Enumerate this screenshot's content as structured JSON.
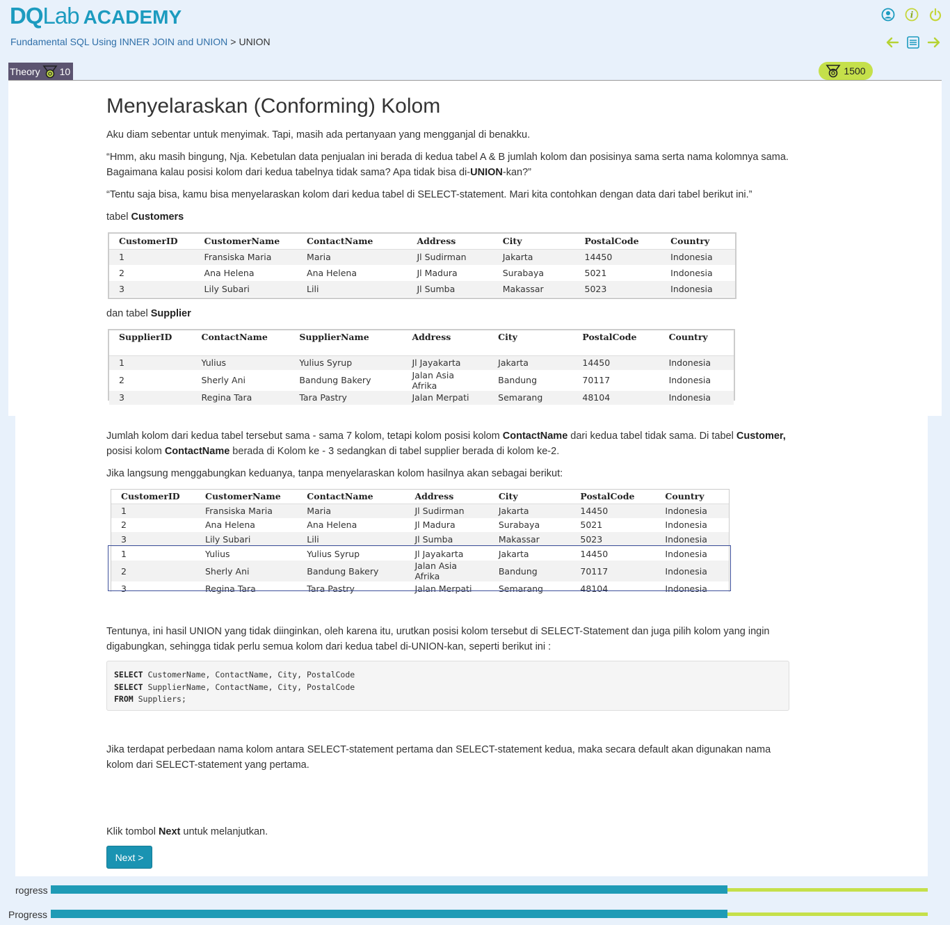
{
  "header": {
    "logo_dq": "DQ",
    "logo_lab": "Lab",
    "logo_academy": "ACADEMY",
    "breadcrumb": {
      "course": "Fundamental SQL Using INNER JOIN and UNION",
      "separator": ">",
      "current": "UNION"
    },
    "icons": [
      "user-icon",
      "info-icon",
      "power-icon"
    ],
    "nav_icons": [
      "arrow-left-icon",
      "list-icon",
      "arrow-right-icon"
    ],
    "theory_label": "Theory",
    "theory_points": "10",
    "total_points": "1500",
    "accent": "#1c9bbf",
    "badge_color": "#c5e04a"
  },
  "lesson": {
    "title": "Menyelaraskan (Conforming) Kolom",
    "p1": "Aku diam sebentar untuk menyimak. Tapi, masih ada pertanyaan yang mengganjal di benakku.",
    "p2_a": "“Hmm, aku masih bingung, Nja. Kebetulan data penjualan ini berada di kedua tabel A & B jumlah kolom dan posisinya sama serta nama kolomnya sama. Bagaimana kalau posisi kolom dari kedua tabelnya tidak sama? Apa tidak bisa di-",
    "p2_b": "UNION",
    "p2_c": "-kan?”",
    "p3": "“Tentu saja bisa, kamu bisa menyelaraskan kolom dari kedua tabel di SELECT-statement. Mari kita contohkan dengan data dari tabel berikut ini.”",
    "customers_prefix": "tabel ",
    "customers_name": "Customers",
    "supplier_prefix": "dan tabel ",
    "supplier_name": "Supplier",
    "p4_a": "Jumlah kolom dari kedua tabel tersebut sama - sama 7 kolom, tetapi kolom posisi kolom ",
    "p4_b": "ContactName",
    "p4_c": " dari kedua tabel tidak sama. Di tabel ",
    "p4_d": "Customer,",
    "p4_e": " posisi kolom ",
    "p4_f": "ContactName",
    "p4_g": " berada di Kolom ke - 3 sedangkan di tabel supplier berada di kolom ke-2.",
    "p5": "Jika langsung menggabungkan keduanya, tanpa menyelaraskan kolom hasilnya akan sebagai berikut:",
    "p6": "Tentunya, ini hasil UNION yang tidak diinginkan, oleh karena itu, urutkan posisi kolom tersebut di SELECT-Statement dan juga pilih kolom yang ingin digabungkan, sehingga tidak perlu semua kolom dari kedua tabel di-UNION-kan, seperti berikut ini :",
    "code": [
      {
        "kw": "SELECT",
        "rest": " CustomerName, ContactName, City, PostalCode"
      },
      {
        "kw": "SELECT",
        "rest": " SupplierName, ContactName, City, PostalCode"
      },
      {
        "kw": "FROM",
        "rest": " Suppliers;"
      }
    ],
    "p7": "Jika terdapat perbedaan nama kolom antara SELECT-statement pertama dan SELECT-statement kedua, maka secara default akan digunakan nama kolom dari SELECT-statement yang pertama.",
    "p8_a": "Klik tombol ",
    "p8_b": "Next",
    "p8_c": " untuk melanjutkan.",
    "next_label": "Next >"
  },
  "customers_table": {
    "headers": [
      "CustomerID",
      "CustomerName",
      "ContactName",
      "Address",
      "City",
      "PostalCode",
      "Country"
    ],
    "rows": [
      [
        "1",
        "Fransiska Maria",
        "Maria",
        "Jl Sudirman",
        "Jakarta",
        "14450",
        "Indonesia"
      ],
      [
        "2",
        "Ana Helena",
        "Ana Helena",
        "Jl Madura",
        "Surabaya",
        "5021",
        "Indonesia"
      ],
      [
        "3",
        "Lily Subari",
        "Lili",
        "Jl Sumba",
        "Makassar",
        "5023",
        "Indonesia"
      ]
    ]
  },
  "supplier_table": {
    "headers": [
      "SupplierID",
      "ContactName",
      "SupplierName",
      "Address",
      "City",
      "PostalCode",
      "Country"
    ],
    "rows": [
      [
        "1",
        "Yulius",
        "Yulius Syrup",
        "Jl Jayakarta",
        "Jakarta",
        "14450",
        "Indonesia"
      ],
      [
        "2",
        "Sherly Ani",
        "Bandung Bakery",
        "Jalan Asia Afrika",
        "Bandung",
        "70117",
        "Indonesia"
      ],
      [
        "3",
        "Regina Tara",
        "Tara Pastry",
        "Jalan Merpati",
        "Semarang",
        "48104",
        "Indonesia"
      ]
    ]
  },
  "union_table": {
    "headers": [
      "CustomerID",
      "CustomerName",
      "ContactName",
      "Address",
      "City",
      "PostalCode",
      "Country"
    ],
    "rows": [
      [
        "1",
        "Fransiska Maria",
        "Maria",
        "Jl Sudirman",
        "Jakarta",
        "14450",
        "Indonesia"
      ],
      [
        "2",
        "Ana Helena",
        "Ana Helena",
        "Jl Madura",
        "Surabaya",
        "5021",
        "Indonesia"
      ],
      [
        "3",
        "Lily Subari",
        "Lili",
        "Jl Sumba",
        "Makassar",
        "5023",
        "Indonesia"
      ],
      [
        "1",
        "Yulius",
        "Yulius Syrup",
        "Jl Jayakarta",
        "Jakarta",
        "14450",
        "Indonesia"
      ],
      [
        "2",
        "Sherly Ani",
        "Bandung Bakery",
        "Jalan Asia Afrika",
        "Bandung",
        "70117",
        "Indonesia"
      ],
      [
        "3",
        "Regina Tara",
        "Tara Pastry",
        "Jalan Merpati",
        "Semarang",
        "48104",
        "Indonesia"
      ]
    ]
  },
  "progress": {
    "label_cut": "rogress",
    "label": "Progress",
    "value": 0.772
  }
}
